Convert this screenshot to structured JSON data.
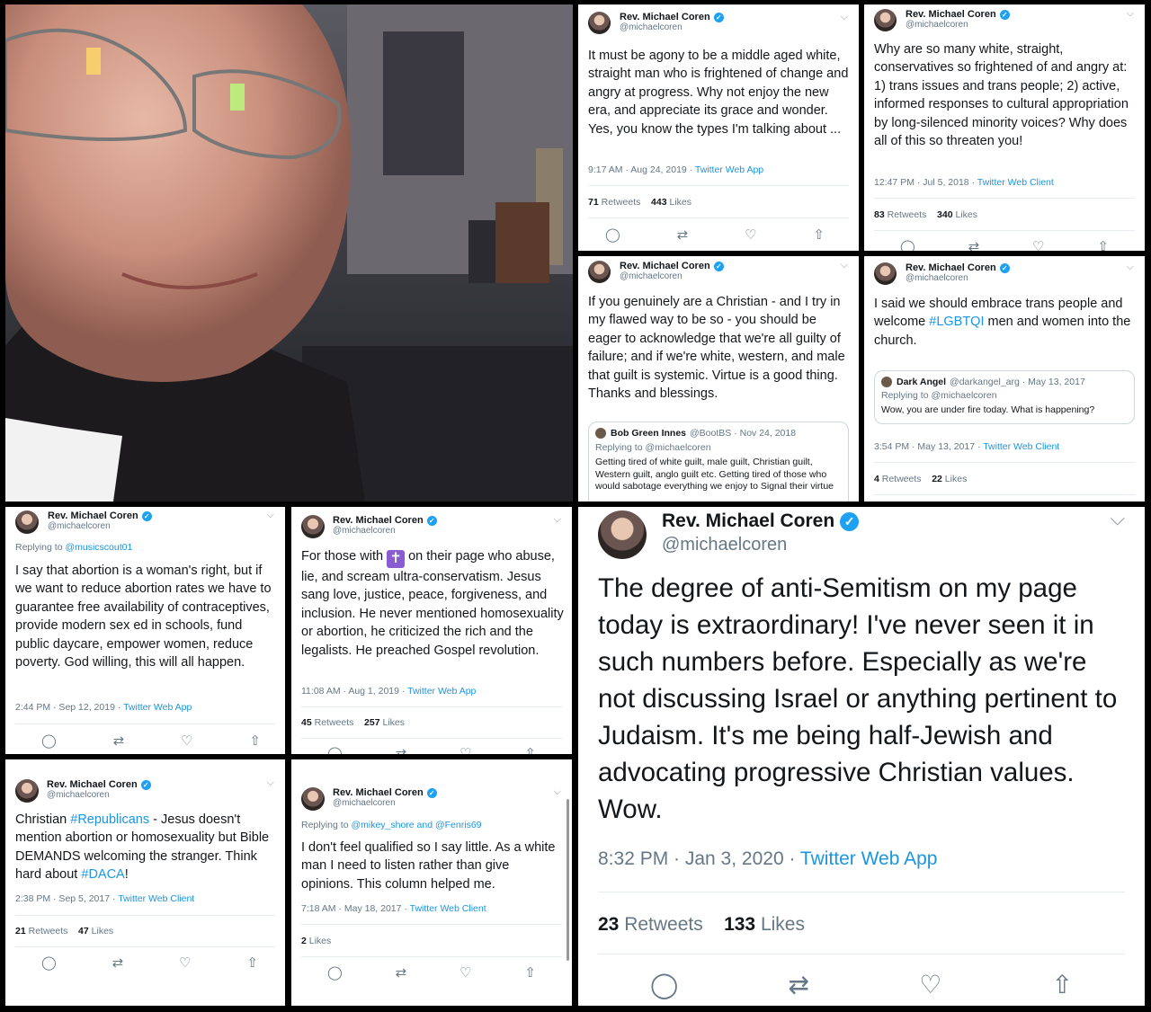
{
  "author": {
    "name": "Rev. Michael Coren",
    "handle": "@michaelcoren"
  },
  "icons": {
    "verified": "verified-badge-icon",
    "menu": "chevron-down-icon",
    "actions": [
      "reply-icon",
      "retweet-icon",
      "like-icon",
      "share-icon"
    ]
  },
  "colors": {
    "link": "#1b95e0",
    "verified": "#1da1f2",
    "muted": "#657786"
  },
  "tweets": {
    "t1": {
      "text": "It must be agony to be a middle aged white, straight man who is frightened of change and angry at progress. Why not enjoy the new era, and appreciate its grace and wonder. Yes, you know the types I'm talking about ...",
      "time": "9:17 AM · Aug 24, 2019 · ",
      "client": "Twitter Web App",
      "retweets": "71",
      "retweets_label": " Retweets",
      "likes": "443",
      "likes_label": " Likes"
    },
    "t2": {
      "text": "Why are so many white, straight, conservatives so frightened of and angry at: 1) trans issues and trans people; 2) active, informed responses to cultural appropriation by long-silenced minority voices? Why does all of this so threaten you!",
      "time": "12:47 PM · Jul 5, 2018 · ",
      "client": "Twitter Web Client",
      "retweets": "83",
      "retweets_label": " Retweets",
      "likes": "340",
      "likes_label": " Likes"
    },
    "t3": {
      "text": "If you genuinely are a Christian - and I try in my flawed way to be so - you should be eager to acknowledge that we're all guilty of failure; and if we're white, western, and male that guilt is systemic. Virtue is a good thing. Thanks and blessings.",
      "quote": {
        "name": "Bob Green Innes",
        "meta": "@BootBS · Nov 24, 2018",
        "reply_prefix": "Replying to ",
        "reply_to": "@michaelcoren",
        "text": "Getting tired of white guilt, male guilt, Christian guilt, Western guilt, anglo guilt etc. Getting tired of those who would sabotage everything we enjoy to Signal their virtue"
      }
    },
    "t4": {
      "text_a": "I said we should embrace trans people and welcome ",
      "hashtag": "#LGBTQI",
      "text_b": " men and women into the church.",
      "quote": {
        "name": "Dark Angel",
        "meta": "@darkangel_arg · May 13, 2017",
        "reply_prefix": "Replying to ",
        "reply_to": "@michaelcoren",
        "text": "Wow, you are under fire today. What is happening?"
      },
      "time": "3:54 PM · May 13, 2017 · ",
      "client": "Twitter Web Client",
      "retweets": "4",
      "retweets_label": " Retweets",
      "likes": "22",
      "likes_label": " Likes"
    },
    "t5": {
      "reply_prefix": "Replying to ",
      "reply_to": "@musicscout01",
      "text": "I say that abortion is a woman's right, but if we want to reduce abortion rates we have to guarantee free availability of contraceptives, provide modern sex ed in schools, fund public daycare, empower women, reduce poverty. God willing, this will all happen.",
      "time": "2:44 PM · Sep 12, 2019 · ",
      "client": "Twitter Web App"
    },
    "t6": {
      "text_a": "For those with ",
      "emoji": "✝",
      "text_b": " on their page who abuse, lie, and scream ultra-conservatism. Jesus sang love, justice, peace, forgiveness, and inclusion. He never mentioned homosexuality or abortion, he criticized the rich and the legalists. He preached Gospel revolution.",
      "time": "11:08 AM · Aug 1, 2019 · ",
      "client": "Twitter Web App",
      "retweets": "45",
      "retweets_label": " Retweets",
      "likes": "257",
      "likes_label": " Likes"
    },
    "t7": {
      "text_a": "Christian ",
      "hashtag1": "#Republicans",
      "text_b": " - Jesus doesn't mention abortion or homosexuality but Bible DEMANDS welcoming the stranger. Think hard about ",
      "hashtag2": "#DACA",
      "text_c": "!",
      "time": "2:38 PM · Sep 5, 2017 · ",
      "client": "Twitter Web Client",
      "retweets": "21",
      "retweets_label": " Retweets",
      "likes": "47",
      "likes_label": " Likes"
    },
    "t8": {
      "reply_prefix": "Replying to ",
      "reply_to": "@mikey_shore and @Fenris69",
      "text": "I don't feel qualified so I say little. As a white man I need to listen rather than give opinions. This column helped me.",
      "time": "7:18 AM · May 18, 2017 · ",
      "client": "Twitter Web Client",
      "likes": "2",
      "likes_label": " Likes"
    },
    "t9": {
      "text": "The degree of anti-Semitism on my page today is extraordinary! I've never seen it in such numbers before. Especially as we're not discussing Israel or anything pertinent to Judaism. It's me being half-Jewish and advocating progressive Christian values. Wow.",
      "time": "8:32 PM · Jan 3, 2020 · ",
      "client": "Twitter Web App",
      "retweets": "23",
      "retweets_label": " Retweets",
      "likes": "133",
      "likes_label": " Likes"
    }
  }
}
